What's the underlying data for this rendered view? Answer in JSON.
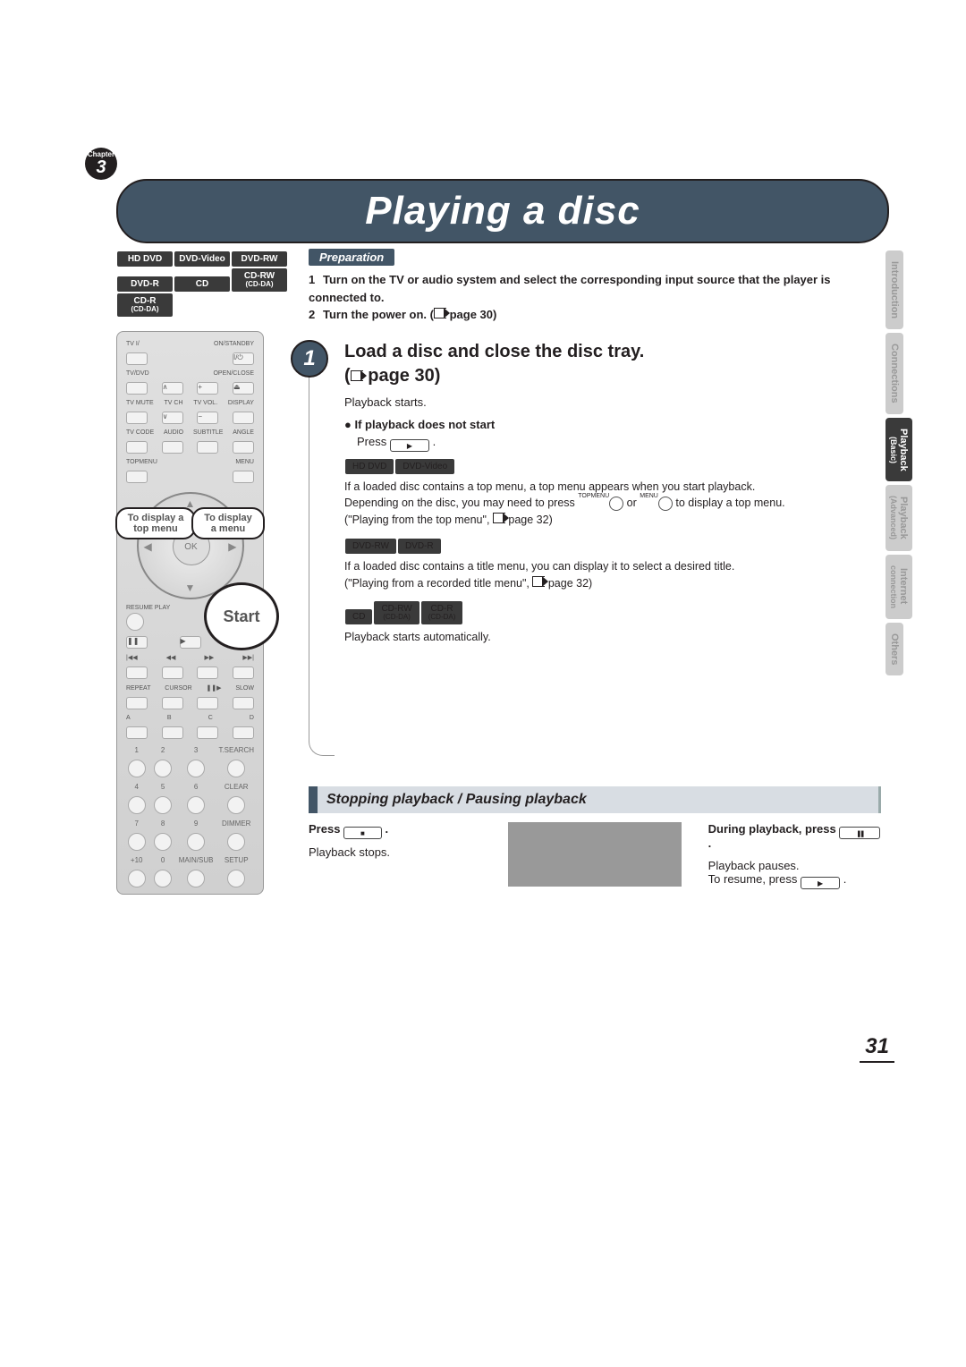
{
  "chapter": {
    "label": "Chapter",
    "number": "3",
    "title": "Playback (Basic)"
  },
  "page_title": "Playing a disc",
  "disc_types": [
    "HD DVD",
    "DVD-Video",
    "DVD-RW",
    "DVD-R",
    "CD",
    "CD-RW (CD-DA)",
    "CD-R (CD-DA)"
  ],
  "side_tabs": [
    {
      "t": "Introduction",
      "active": false
    },
    {
      "t": "Connections",
      "active": false
    },
    {
      "t": "Playback",
      "sub": "(Basic)",
      "active": true
    },
    {
      "t": "Playback",
      "sub": "(Advanced)",
      "active": false
    },
    {
      "t": "Internet",
      "sub": "connection",
      "active": false
    },
    {
      "t": "Others",
      "active": false
    }
  ],
  "preparation": {
    "label": "Preparation",
    "items": [
      "Turn on the TV or audio system and select the corresponding input source that the player is connected to.",
      "Turn the power on. (     page 30)"
    ]
  },
  "step1": {
    "title": "Load a disc and close the disc tray.",
    "page_ref": "(     page 30)",
    "starts": "Playback starts.",
    "if_not": "If playback does not start",
    "press": "Press",
    "group1_chips": [
      "HD DVD",
      "DVD-Video"
    ],
    "group1_text1": "If a loaded disc contains a top menu, a top menu appears when you start playback.",
    "group1_text2_a": "Depending on the disc, you may need to press ",
    "group1_text2_b": " or ",
    "group1_text2_c": " to display a top menu.",
    "topmenu": "TOPMENU",
    "menu": "MENU",
    "group1_ref": "(\"Playing from the top menu\",      page 32)",
    "group2_chips": [
      "DVD-RW",
      "DVD-R"
    ],
    "group2_text": "If a loaded disc contains a title menu, you can display it to select a desired title.",
    "group2_ref": "(\"Playing from a recorded title menu\",      page 32)",
    "group3_chips": [
      "CD",
      "CD-RW (CD-DA)",
      "CD-R (CD-DA)"
    ],
    "group3_text": "Playback starts automatically."
  },
  "stopping": {
    "heading": "Stopping playback / Pausing playback",
    "left_press": "Press ",
    "left_text": "Playback stops.",
    "right_press": "During playback, press ",
    "right_text1": "Playback pauses.",
    "right_text2": "To resume, press "
  },
  "remote": {
    "row1": [
      "TV I/",
      "ON/STANDBY"
    ],
    "row2": [
      "TV/DVD",
      "OPEN/CLOSE"
    ],
    "row3": [
      "TV MUTE",
      "TV CH",
      "TV VOL.",
      "DISPLAY"
    ],
    "row4": [
      "TV CODE",
      "AUDIO",
      "SUBTITLE",
      "ANGLE"
    ],
    "row5": [
      "TOPMENU",
      "",
      "",
      "MENU"
    ],
    "ok": "OK",
    "resume": "RESUME PLAY",
    "transport": [
      "❚❚",
      "▶",
      "■"
    ],
    "skip": [
      "|◀◀",
      "◀◀",
      "▶▶",
      "▶▶|"
    ],
    "row_low": [
      "REPEAT",
      "CURSOR",
      "❚❚▶",
      "SLOW"
    ],
    "abcd": [
      "A",
      "B",
      "C",
      "D"
    ],
    "nums": [
      "1",
      "2",
      "3",
      "T.SEARCH",
      "4",
      "5",
      "6",
      "CLEAR",
      "7",
      "8",
      "9",
      "DIMMER",
      "+10",
      "0",
      "MAIN/SUB",
      "SETUP"
    ]
  },
  "callouts": {
    "topmenu": "To display a top menu",
    "menu": "To display a menu",
    "start": "Start"
  },
  "page_number": "31"
}
